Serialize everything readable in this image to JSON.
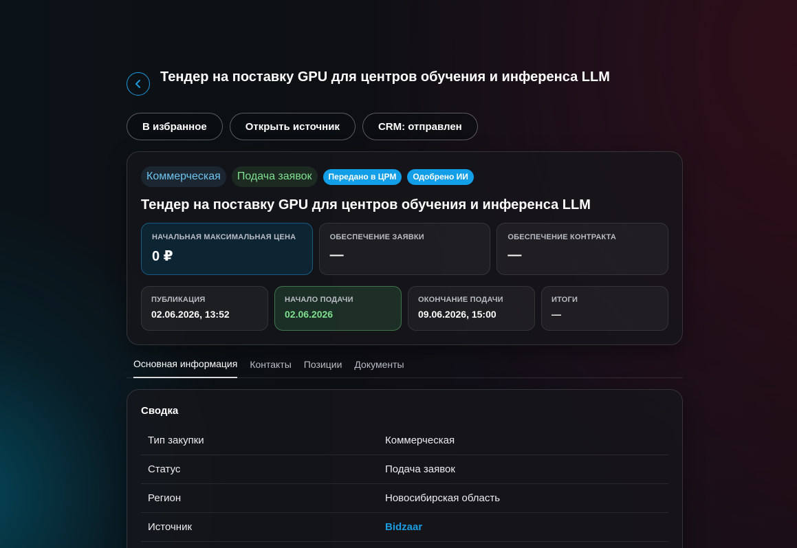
{
  "header": {
    "back_icon": "chevron-left-icon",
    "title": "Тендер на поставку GPU для центров обучения и инференса LLM"
  },
  "actions": {
    "favorite": "В избранное",
    "open_source": "Открыть источник",
    "crm": "CRM: отправлен"
  },
  "tags": {
    "type": "Коммерческая",
    "status": "Подача заявок",
    "crm": "Передано в ЦРМ",
    "ai": "Одобрено ИИ"
  },
  "card_title": "Тендер на поставку GPU для центров обучения и инференса LLM",
  "stats": [
    {
      "label": "НАЧАЛЬНАЯ МАКСИМАЛЬНАЯ ЦЕНА",
      "value": "0 ₽"
    },
    {
      "label": "ОБЕСПЕЧЕНИЕ ЗАЯВКИ",
      "value": "—"
    },
    {
      "label": "ОБЕСПЕЧЕНИЕ КОНТРАКТА",
      "value": "—"
    }
  ],
  "dates": [
    {
      "label": "ПУБЛИКАЦИЯ",
      "value": "02.06.2026, 13:52"
    },
    {
      "label": "НАЧАЛО ПОДАЧИ",
      "value": "02.06.2026"
    },
    {
      "label": "ОКОНЧАНИЕ ПОДАЧИ",
      "value": "09.06.2026, 15:00"
    },
    {
      "label": "ИТОГИ",
      "value": "—"
    }
  ],
  "tabs": [
    "Основная информация",
    "Контакты",
    "Позиции",
    "Документы"
  ],
  "summary": {
    "title": "Сводка",
    "rows": [
      {
        "label": "Тип закупки",
        "value": "Коммерческая"
      },
      {
        "label": "Статус",
        "value": "Подача заявок"
      },
      {
        "label": "Регион",
        "value": "Новосибирская область"
      },
      {
        "label": "Источник",
        "value": "Bidzaar"
      }
    ]
  },
  "colors": {
    "accent": "#1c9be0",
    "green": "#7fe08f",
    "badge": "#139ee8"
  }
}
